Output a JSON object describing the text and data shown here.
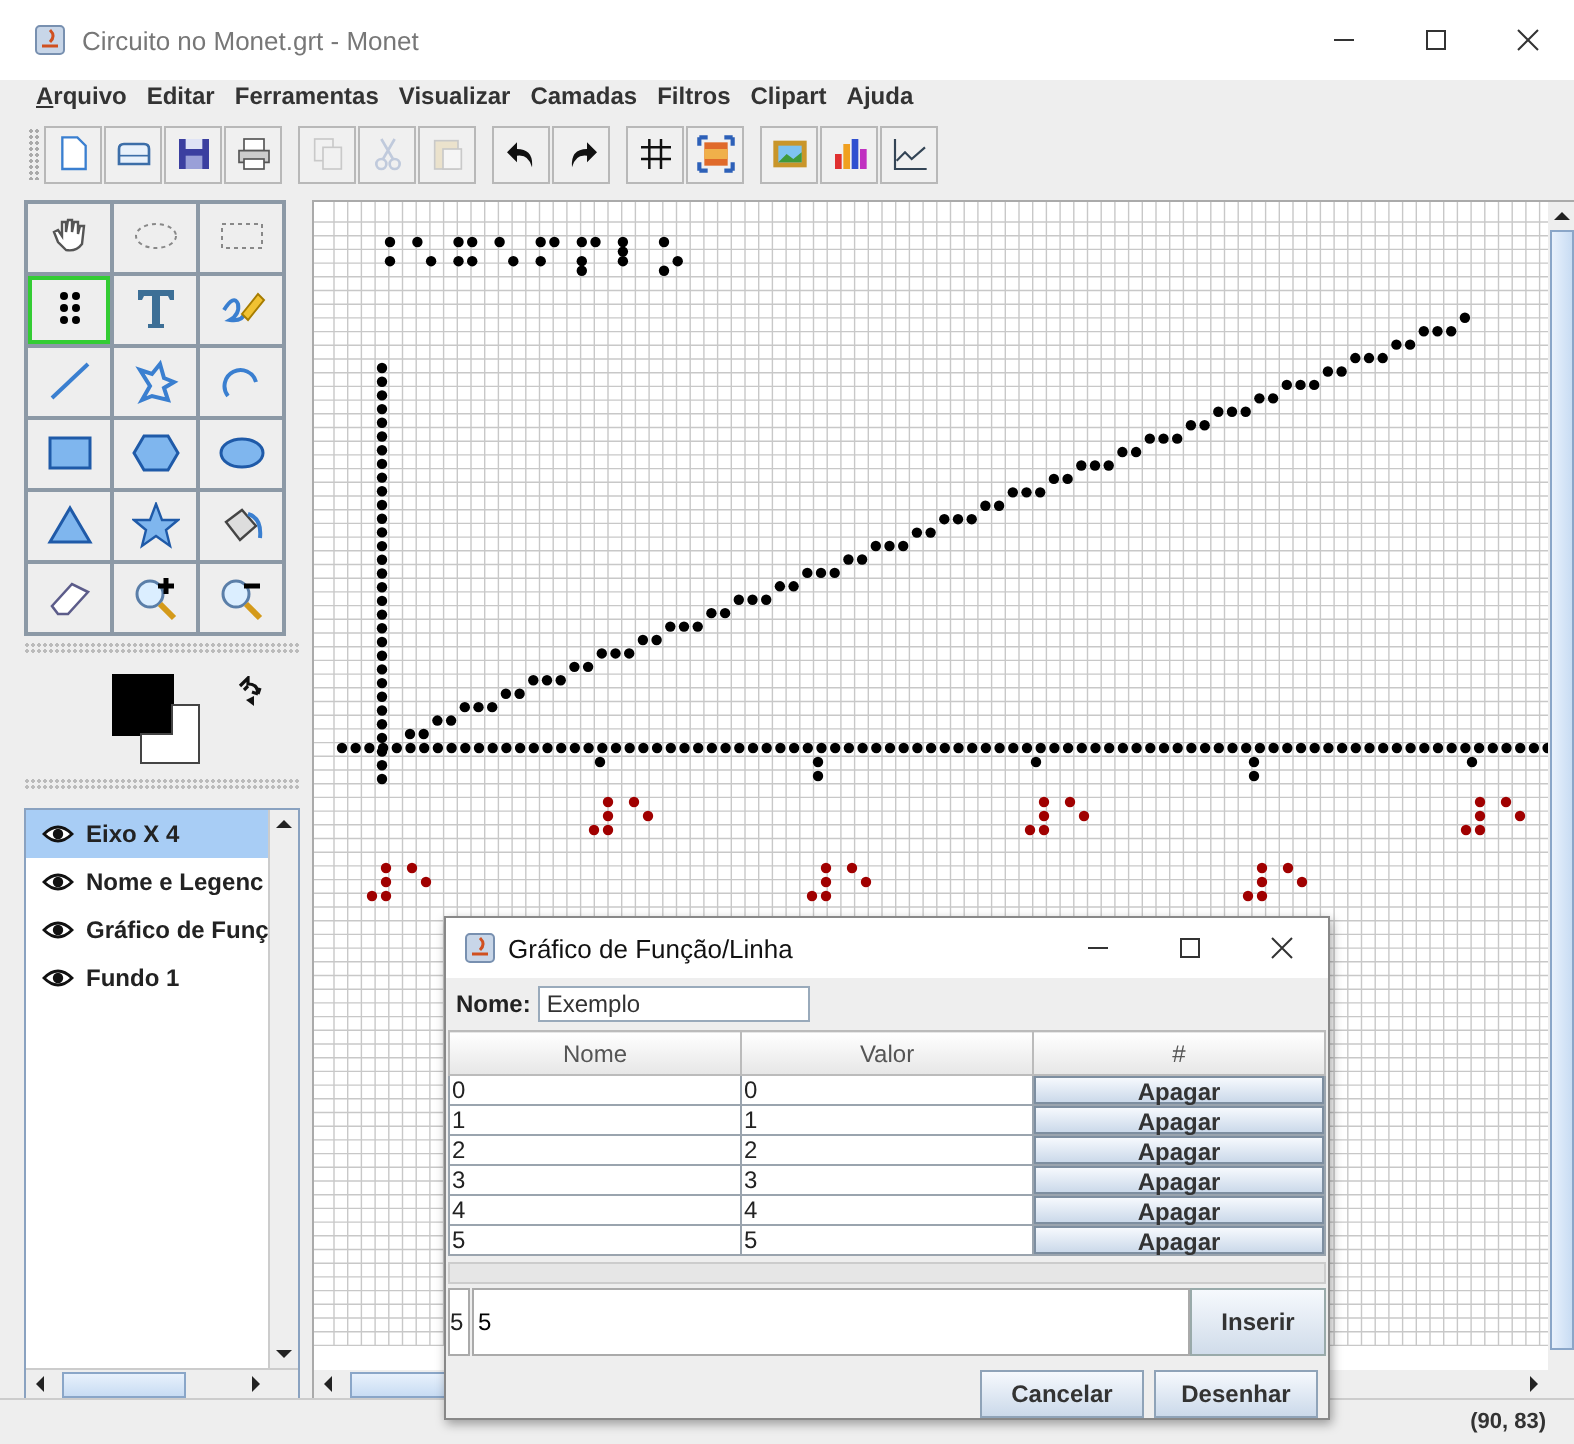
{
  "window": {
    "title": "Circuito no Monet.grt - Monet"
  },
  "menu": [
    {
      "label": "Arquivo",
      "mnemonic": true
    },
    {
      "label": "Editar",
      "mnemonic": false
    },
    {
      "label": "Ferramentas",
      "mnemonic": false
    },
    {
      "label": "Visualizar",
      "mnemonic": false
    },
    {
      "label": "Camadas",
      "mnemonic": false
    },
    {
      "label": "Filtros",
      "mnemonic": false
    },
    {
      "label": "Clipart",
      "mnemonic": false
    },
    {
      "label": "Ajuda",
      "mnemonic": false
    }
  ],
  "toolbar": {
    "groups": [
      {
        "buttons": [
          {
            "kind": "new",
            "disabled": false
          },
          {
            "kind": "open",
            "disabled": false
          },
          {
            "kind": "save",
            "disabled": false
          },
          {
            "kind": "print",
            "disabled": false
          }
        ]
      },
      {
        "buttons": [
          {
            "kind": "copy",
            "disabled": true
          },
          {
            "kind": "cut",
            "disabled": true
          },
          {
            "kind": "paste",
            "disabled": true
          }
        ]
      },
      {
        "buttons": [
          {
            "kind": "undo",
            "disabled": false
          },
          {
            "kind": "redo",
            "disabled": false
          }
        ]
      },
      {
        "buttons": [
          {
            "kind": "grid",
            "disabled": false
          },
          {
            "kind": "fit",
            "disabled": false
          }
        ]
      },
      {
        "buttons": [
          {
            "kind": "image",
            "disabled": false
          },
          {
            "kind": "barchart",
            "disabled": false
          },
          {
            "kind": "linechart",
            "disabled": false
          }
        ]
      }
    ]
  },
  "tools": [
    {
      "kind": "hand",
      "selected": false
    },
    {
      "kind": "ellipse-select",
      "selected": false
    },
    {
      "kind": "rect-select",
      "selected": false
    },
    {
      "kind": "dots",
      "selected": true
    },
    {
      "kind": "text",
      "selected": false
    },
    {
      "kind": "pencil",
      "selected": false
    },
    {
      "kind": "line",
      "selected": false
    },
    {
      "kind": "freeform",
      "selected": false
    },
    {
      "kind": "arc",
      "selected": false
    },
    {
      "kind": "rectangle",
      "selected": false
    },
    {
      "kind": "hexagon",
      "selected": false
    },
    {
      "kind": "ellipse",
      "selected": false
    },
    {
      "kind": "triangle",
      "selected": false
    },
    {
      "kind": "star",
      "selected": false
    },
    {
      "kind": "fill",
      "selected": false
    },
    {
      "kind": "eraser",
      "selected": false
    },
    {
      "kind": "zoom-in",
      "selected": false
    },
    {
      "kind": "zoom-out",
      "selected": false
    }
  ],
  "colors": [
    {
      "kind": "foreground",
      "color": "#000000"
    },
    {
      "kind": "background",
      "color": "#ffffff"
    }
  ],
  "layers": [
    {
      "name": "Eixo X 4",
      "selected": true
    },
    {
      "name": "Nome e Legenc",
      "selected": false
    },
    {
      "name": "Gráfico de Funç",
      "selected": false
    },
    {
      "name": "Fundo 1",
      "selected": false
    }
  ],
  "dialog": {
    "title": "Gráfico de Função/Linha",
    "name_label": "Nome:",
    "name_value": "Exemplo",
    "columns": [
      "Nome",
      "Valor",
      "#"
    ],
    "rows": [
      {
        "nome": "0",
        "valor": "0",
        "action": "Apagar"
      },
      {
        "nome": "1",
        "valor": "1",
        "action": "Apagar"
      },
      {
        "nome": "2",
        "valor": "2",
        "action": "Apagar"
      },
      {
        "nome": "3",
        "valor": "3",
        "action": "Apagar"
      },
      {
        "nome": "4",
        "valor": "4",
        "action": "Apagar"
      },
      {
        "nome": "5",
        "valor": "5",
        "action": "Apagar"
      }
    ],
    "index_value": "5",
    "input_value": "5",
    "insert_button": "Inserir",
    "cancel_button": "Cancelar",
    "draw_button": "Desenhar"
  },
  "status_bar": {
    "coordinates": "(90, 83)"
  }
}
